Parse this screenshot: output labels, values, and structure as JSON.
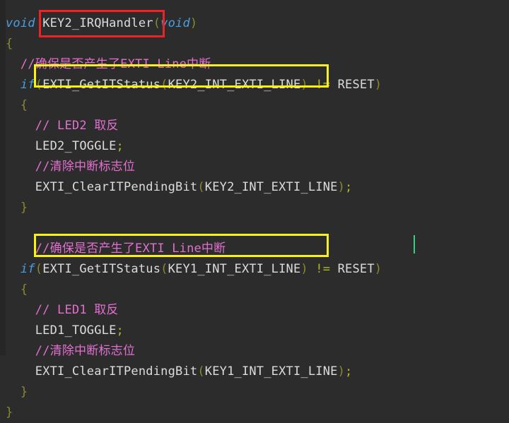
{
  "editor": {
    "language": "c",
    "background_color": "#2c2c2c",
    "gutter_color": "#262626",
    "default_text_color": "#d4d4d4",
    "comment_color": "#e36fd0",
    "keyword_color": "#4a9fe0",
    "brace_color": "#8a8a2a",
    "operator_color": "#b5b52e",
    "caret_color": "#33d17a"
  },
  "annotations": {
    "red_box": {
      "color": "#ee2222",
      "target_text": "KEY2_IRQHandler"
    },
    "yellow_box_1": {
      "color": "#fbf215",
      "target_text": "(EXTI_GetITStatus(KEY2_INT_EXTI_LINE)"
    },
    "yellow_box_2": {
      "color": "#fbf215",
      "target_text": "(EXTI_GetITStatus(KEY1_INT_EXTI_LINE)"
    }
  },
  "code": {
    "lines": [
      {
        "n": 1,
        "text": "void KEY2_IRQHandler(void)",
        "tokens": [
          {
            "t": "void",
            "c": "kw"
          },
          {
            "t": " ",
            "c": "plain"
          },
          {
            "t": "KEY2_IRQHandler",
            "c": "ident"
          },
          {
            "t": "(",
            "c": "paren"
          },
          {
            "t": "void",
            "c": "kw"
          },
          {
            "t": ")",
            "c": "paren"
          }
        ]
      },
      {
        "n": 2,
        "text": "{",
        "tokens": [
          {
            "t": "{",
            "c": "brace"
          }
        ]
      },
      {
        "n": 3,
        "text": "  //确保是否产生了EXTI Line中断",
        "tokens": [
          {
            "t": "  ",
            "c": "plain"
          },
          {
            "t": "//确保是否产生了EXTI Line中断",
            "c": "comment"
          }
        ]
      },
      {
        "n": 4,
        "text": "  if(EXTI_GetITStatus(KEY2_INT_EXTI_LINE) != RESET)",
        "tokens": [
          {
            "t": "  ",
            "c": "plain"
          },
          {
            "t": "if",
            "c": "kw"
          },
          {
            "t": "(",
            "c": "paren"
          },
          {
            "t": "EXTI_GetITStatus",
            "c": "ident"
          },
          {
            "t": "(",
            "c": "paren"
          },
          {
            "t": "KEY2_INT_EXTI_LINE",
            "c": "ident"
          },
          {
            "t": ")",
            "c": "paren"
          },
          {
            "t": " ",
            "c": "plain"
          },
          {
            "t": "!=",
            "c": "op"
          },
          {
            "t": " ",
            "c": "plain"
          },
          {
            "t": "RESET",
            "c": "ident"
          },
          {
            "t": ")",
            "c": "paren"
          }
        ]
      },
      {
        "n": 5,
        "text": "  {",
        "tokens": [
          {
            "t": "  ",
            "c": "plain"
          },
          {
            "t": "{",
            "c": "brace"
          }
        ]
      },
      {
        "n": 6,
        "text": "    // LED2 取反",
        "tokens": [
          {
            "t": "    ",
            "c": "plain"
          },
          {
            "t": "// LED2 取反",
            "c": "comment"
          }
        ]
      },
      {
        "n": 7,
        "text": "    LED2_TOGGLE;",
        "tokens": [
          {
            "t": "    ",
            "c": "plain"
          },
          {
            "t": "LED2_TOGGLE",
            "c": "ident"
          },
          {
            "t": ";",
            "c": "semi"
          }
        ]
      },
      {
        "n": 8,
        "text": "    //清除中断标志位",
        "tokens": [
          {
            "t": "    ",
            "c": "plain"
          },
          {
            "t": "//清除中断标志位",
            "c": "comment"
          }
        ]
      },
      {
        "n": 9,
        "text": "    EXTI_ClearITPendingBit(KEY2_INT_EXTI_LINE);",
        "tokens": [
          {
            "t": "    ",
            "c": "plain"
          },
          {
            "t": "EXTI_ClearITPendingBit",
            "c": "ident"
          },
          {
            "t": "(",
            "c": "paren"
          },
          {
            "t": "KEY2_INT_EXTI_LINE",
            "c": "ident"
          },
          {
            "t": ")",
            "c": "paren"
          },
          {
            "t": ";",
            "c": "semi"
          }
        ]
      },
      {
        "n": 10,
        "text": "  }",
        "tokens": [
          {
            "t": "  ",
            "c": "plain"
          },
          {
            "t": "}",
            "c": "brace"
          }
        ]
      },
      {
        "n": 11,
        "text": "",
        "tokens": []
      },
      {
        "n": 12,
        "text": "    //确保是否产生了EXTI Line中断",
        "tokens": [
          {
            "t": "    ",
            "c": "plain"
          },
          {
            "t": "//确保是否产生了EXTI Line中断",
            "c": "comment"
          }
        ]
      },
      {
        "n": 13,
        "text": "  if(EXTI_GetITStatus(KEY1_INT_EXTI_LINE) != RESET)",
        "tokens": [
          {
            "t": "  ",
            "c": "plain"
          },
          {
            "t": "if",
            "c": "kw"
          },
          {
            "t": "(",
            "c": "paren"
          },
          {
            "t": "EXTI_GetITStatus",
            "c": "ident"
          },
          {
            "t": "(",
            "c": "paren"
          },
          {
            "t": "KEY1_INT_EXTI_LINE",
            "c": "ident"
          },
          {
            "t": ")",
            "c": "paren"
          },
          {
            "t": " ",
            "c": "plain"
          },
          {
            "t": "!=",
            "c": "op"
          },
          {
            "t": " ",
            "c": "plain"
          },
          {
            "t": "RESET",
            "c": "ident"
          },
          {
            "t": ")",
            "c": "paren"
          }
        ]
      },
      {
        "n": 14,
        "text": "  {",
        "tokens": [
          {
            "t": "  ",
            "c": "plain"
          },
          {
            "t": "{",
            "c": "brace"
          }
        ]
      },
      {
        "n": 15,
        "text": "    // LED1 取反",
        "tokens": [
          {
            "t": "    ",
            "c": "plain"
          },
          {
            "t": "// LED1 取反",
            "c": "comment"
          }
        ]
      },
      {
        "n": 16,
        "text": "    LED1_TOGGLE;",
        "tokens": [
          {
            "t": "    ",
            "c": "plain"
          },
          {
            "t": "LED1_TOGGLE",
            "c": "ident"
          },
          {
            "t": ";",
            "c": "semi"
          }
        ]
      },
      {
        "n": 17,
        "text": "    //清除中断标志位",
        "tokens": [
          {
            "t": "    ",
            "c": "plain"
          },
          {
            "t": "//清除中断标志位",
            "c": "comment"
          }
        ]
      },
      {
        "n": 18,
        "text": "    EXTI_ClearITPendingBit(KEY1_INT_EXTI_LINE);",
        "tokens": [
          {
            "t": "    ",
            "c": "plain"
          },
          {
            "t": "EXTI_ClearITPendingBit",
            "c": "ident"
          },
          {
            "t": "(",
            "c": "paren"
          },
          {
            "t": "KEY1_INT_EXTI_LINE",
            "c": "ident"
          },
          {
            "t": ")",
            "c": "paren"
          },
          {
            "t": ";",
            "c": "semi"
          }
        ]
      },
      {
        "n": 19,
        "text": "  }",
        "tokens": [
          {
            "t": "  ",
            "c": "plain"
          },
          {
            "t": "}",
            "c": "brace"
          }
        ]
      },
      {
        "n": 20,
        "text": "}",
        "tokens": [
          {
            "t": "}",
            "c": "brace"
          }
        ]
      }
    ]
  }
}
